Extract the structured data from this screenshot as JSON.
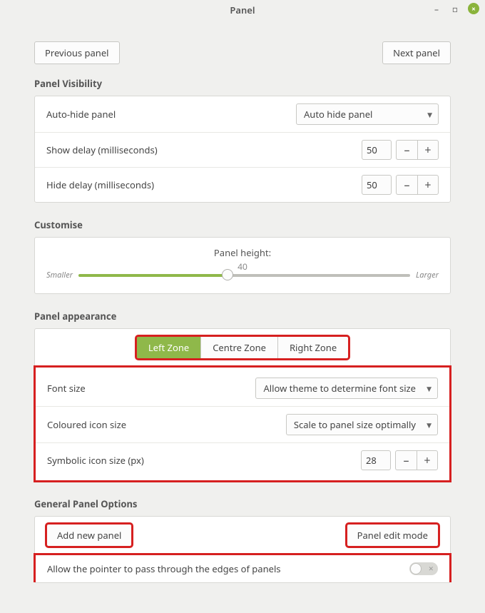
{
  "window": {
    "title": "Panel"
  },
  "nav": {
    "prev": "Previous panel",
    "next": "Next panel"
  },
  "visibility": {
    "heading": "Panel Visibility",
    "autohide_label": "Auto-hide panel",
    "autohide_value": "Auto hide panel",
    "show_delay_label": "Show delay (milliseconds)",
    "show_delay_value": "50",
    "hide_delay_label": "Hide delay (milliseconds)",
    "hide_delay_value": "50"
  },
  "customise": {
    "heading": "Customise",
    "height_label": "Panel height:",
    "height_value": "40",
    "smaller": "Smaller",
    "larger": "Larger"
  },
  "appearance": {
    "heading": "Panel appearance",
    "tabs": {
      "left": "Left Zone",
      "centre": "Centre Zone",
      "right": "Right Zone"
    },
    "font_size_label": "Font size",
    "font_size_value": "Allow theme to determine font size",
    "coloured_label": "Coloured icon size",
    "coloured_value": "Scale to panel size optimally",
    "symbolic_label": "Symbolic icon size (px)",
    "symbolic_value": "28"
  },
  "general": {
    "heading": "General Panel Options",
    "add_btn": "Add new panel",
    "edit_btn": "Panel edit mode",
    "passthrough_label": "Allow the pointer to pass through the edges of panels"
  }
}
